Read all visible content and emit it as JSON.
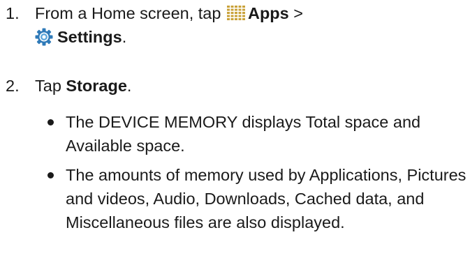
{
  "steps": [
    {
      "number": "1.",
      "text_before": "From a Home screen, tap ",
      "apps_label": "Apps",
      "separator": " >",
      "settings_label": "Settings",
      "text_after": "."
    },
    {
      "number": "2.",
      "text_before": "Tap ",
      "storage_label": "Storage",
      "text_after": "."
    }
  ],
  "bullets": [
    "The DEVICE MEMORY displays Total space and Available space.",
    "The amounts of memory used by Applications, Pictures and videos, Audio, Downloads, Cached data, and Miscellaneous files are also displayed."
  ],
  "icons": {
    "apps": "apps-grid-icon",
    "settings": "gear-icon"
  },
  "colors": {
    "text": "#1a1a1a",
    "apps_icon": "#c9a23a",
    "settings_icon_outer": "#2f7ab8",
    "settings_icon_inner": "#5fa8dc"
  }
}
